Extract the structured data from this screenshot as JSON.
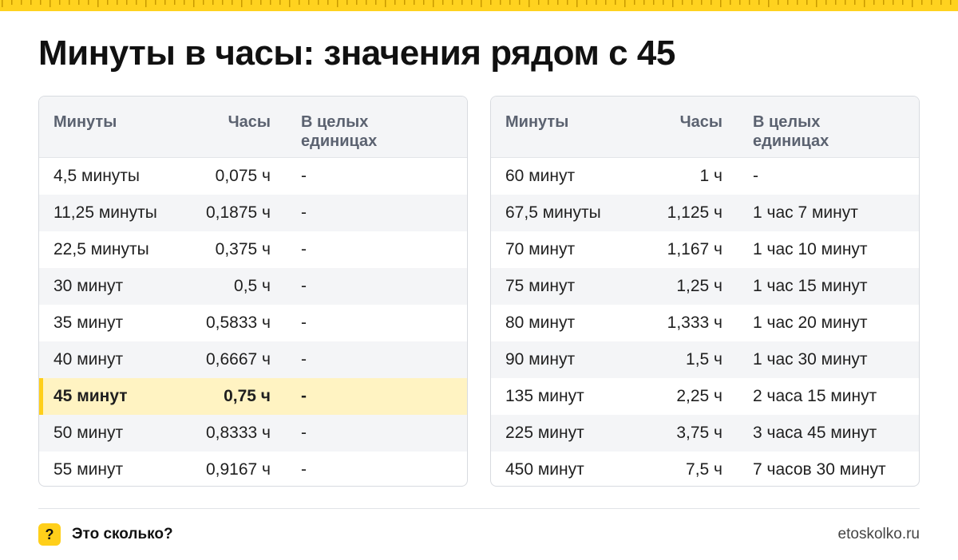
{
  "title": "Минуты в часы: значения рядом с 45",
  "headers": {
    "minutes": "Минуты",
    "hours": "Часы",
    "whole": "В целых единицах"
  },
  "left_table": [
    {
      "minutes": "4,5 минуты",
      "hours": "0,075 ч",
      "whole": "-"
    },
    {
      "minutes": "11,25 минуты",
      "hours": "0,1875 ч",
      "whole": "-"
    },
    {
      "minutes": "22,5 минуты",
      "hours": "0,375 ч",
      "whole": "-"
    },
    {
      "minutes": "30 минут",
      "hours": "0,5 ч",
      "whole": "-"
    },
    {
      "minutes": "35 минут",
      "hours": "0,5833 ч",
      "whole": "-"
    },
    {
      "minutes": "40 минут",
      "hours": "0,6667 ч",
      "whole": "-"
    },
    {
      "minutes": "45 минут",
      "hours": "0,75 ч",
      "whole": "-",
      "highlight": true
    },
    {
      "minutes": "50 минут",
      "hours": "0,8333 ч",
      "whole": "-"
    },
    {
      "minutes": "55 минут",
      "hours": "0,9167 ч",
      "whole": "-"
    }
  ],
  "right_table": [
    {
      "minutes": "60 минут",
      "hours": "1 ч",
      "whole": "-"
    },
    {
      "minutes": "67,5 минуты",
      "hours": "1,125 ч",
      "whole": "1 час 7 минут"
    },
    {
      "minutes": "70 минут",
      "hours": "1,167 ч",
      "whole": "1 час 10 минут"
    },
    {
      "minutes": "75 минут",
      "hours": "1,25 ч",
      "whole": "1 час 15 минут"
    },
    {
      "minutes": "80 минут",
      "hours": "1,333 ч",
      "whole": "1 час 20 минут"
    },
    {
      "minutes": "90 минут",
      "hours": "1,5 ч",
      "whole": "1 час 30 минут"
    },
    {
      "minutes": "135 минут",
      "hours": "2,25 ч",
      "whole": "2 часа 15 минут"
    },
    {
      "minutes": "225 минут",
      "hours": "3,75 ч",
      "whole": "3 часа 45 минут"
    },
    {
      "minutes": "450 минут",
      "hours": "7,5 ч",
      "whole": "7 часов 30 минут"
    }
  ],
  "footer": {
    "logo_glyph": "?",
    "brand": "Это сколько?",
    "site": "etoskolko.ru"
  },
  "colors": {
    "accent": "#ffcf1a",
    "ruler": "#ffd21f",
    "highlight_row": "#fff3c2",
    "header_bg": "#f4f5f7"
  },
  "icons": {
    "logo": "question-mark-icon",
    "ruler": "ruler-ticks-decoration"
  }
}
